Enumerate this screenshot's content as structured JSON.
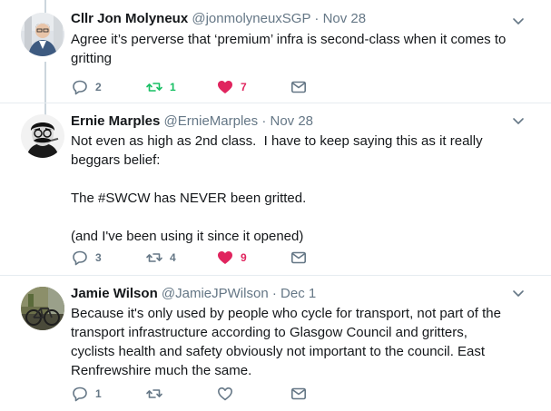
{
  "tweets": [
    {
      "name": "Cllr Jon Molyneux",
      "handle": "@jonmolyneuxSGP",
      "dot": "·",
      "time": "Nov 28",
      "text": "Agree it’s perverse that ‘premium’ infra is second-class when it comes to gritting",
      "replies": "2",
      "retweets": "1",
      "likes": "7",
      "retweeted": true,
      "liked": true
    },
    {
      "name": "Ernie Marples",
      "handle": "@ErnieMarples",
      "dot": "·",
      "time": "Nov 28",
      "text": "Not even as high as 2nd class.  I have to keep saying this as it really beggars belief:\n\nThe #SWCW has NEVER been gritted.\n\n(and I've been using it since it opened)",
      "replies": "3",
      "retweets": "4",
      "likes": "9",
      "retweeted": false,
      "liked": true
    },
    {
      "name": "Jamie Wilson",
      "handle": "@JamieJPWilson",
      "dot": "·",
      "time": "Dec 1",
      "text": "Because it's only used by people who cycle for transport, not part of the transport infrastructure according to Glasgow Council and gritters, cyclists health and safety obviously not important to the council. East Renfrewshire much the same.",
      "replies": "1",
      "retweets": "",
      "likes": "",
      "retweeted": false,
      "liked": false
    }
  ],
  "colors": {
    "retweet_active": "#17bf63",
    "like_active": "#e0245e",
    "icon_default": "#657786"
  }
}
